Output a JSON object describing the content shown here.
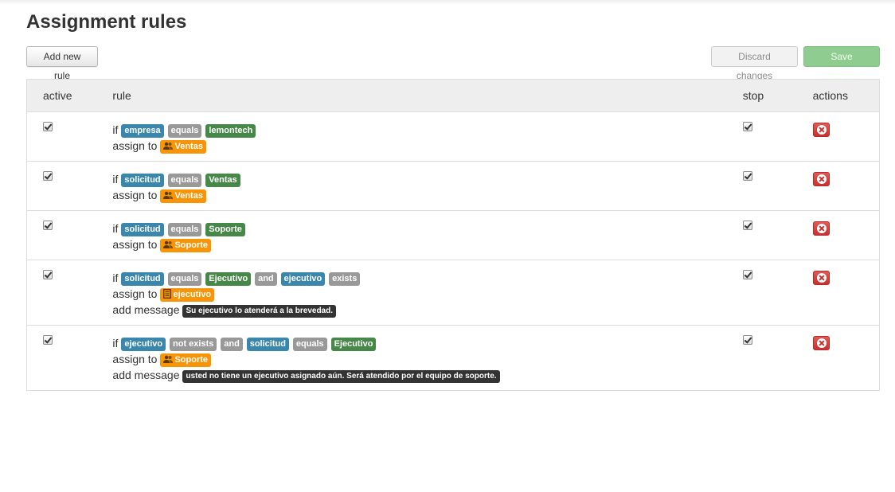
{
  "page": {
    "title": "Assignment rules"
  },
  "toolbar": {
    "add_label": "Add new rule",
    "discard_label": "Discard changes",
    "save_label": "Save changes"
  },
  "table": {
    "headers": {
      "active": "active",
      "rule": "rule",
      "stop": "stop",
      "actions": "actions"
    }
  },
  "keywords": {
    "if": "if",
    "assign_to": "assign to",
    "add_message": "add message"
  },
  "colors": {
    "field": "#3a87ad",
    "operator": "#999999",
    "value": "#468847",
    "target": "#f89406",
    "message": "#333333",
    "delete": "#c9302c",
    "save": "#8fcc8f"
  },
  "rules": [
    {
      "active": true,
      "stop": true,
      "conditions": [
        {
          "text": "empresa",
          "kind": "field"
        },
        {
          "text": "equals",
          "kind": "op"
        },
        {
          "text": "lemontech",
          "kind": "val"
        }
      ],
      "assign": {
        "icon": "group-icon",
        "text": "Ventas"
      },
      "message": ""
    },
    {
      "active": true,
      "stop": true,
      "conditions": [
        {
          "text": "solicitud",
          "kind": "field"
        },
        {
          "text": "equals",
          "kind": "op"
        },
        {
          "text": "Ventas",
          "kind": "val"
        }
      ],
      "assign": {
        "icon": "group-icon",
        "text": "Ventas"
      },
      "message": ""
    },
    {
      "active": true,
      "stop": true,
      "conditions": [
        {
          "text": "solicitud",
          "kind": "field"
        },
        {
          "text": "equals",
          "kind": "op"
        },
        {
          "text": "Soporte",
          "kind": "val"
        }
      ],
      "assign": {
        "icon": "group-icon",
        "text": "Soporte"
      },
      "message": ""
    },
    {
      "active": true,
      "stop": true,
      "conditions": [
        {
          "text": "solicitud",
          "kind": "field"
        },
        {
          "text": "equals",
          "kind": "op"
        },
        {
          "text": "Ejecutivo",
          "kind": "val"
        },
        {
          "text": "and",
          "kind": "op"
        },
        {
          "text": "ejecutivo",
          "kind": "field"
        },
        {
          "text": "exists",
          "kind": "op"
        }
      ],
      "assign": {
        "icon": "document-icon",
        "text": "ejecutivo"
      },
      "message": "Su ejecutivo lo atenderá a la brevedad."
    },
    {
      "active": true,
      "stop": true,
      "conditions": [
        {
          "text": "ejecutivo",
          "kind": "field"
        },
        {
          "text": "not exists",
          "kind": "op"
        },
        {
          "text": "and",
          "kind": "op"
        },
        {
          "text": "solicitud",
          "kind": "field"
        },
        {
          "text": "equals",
          "kind": "op"
        },
        {
          "text": "Ejecutivo",
          "kind": "val"
        }
      ],
      "assign": {
        "icon": "group-icon",
        "text": "Soporte"
      },
      "message": "usted no tiene un ejecutivo asignado aún. Será atendido por el equipo de soporte."
    }
  ]
}
